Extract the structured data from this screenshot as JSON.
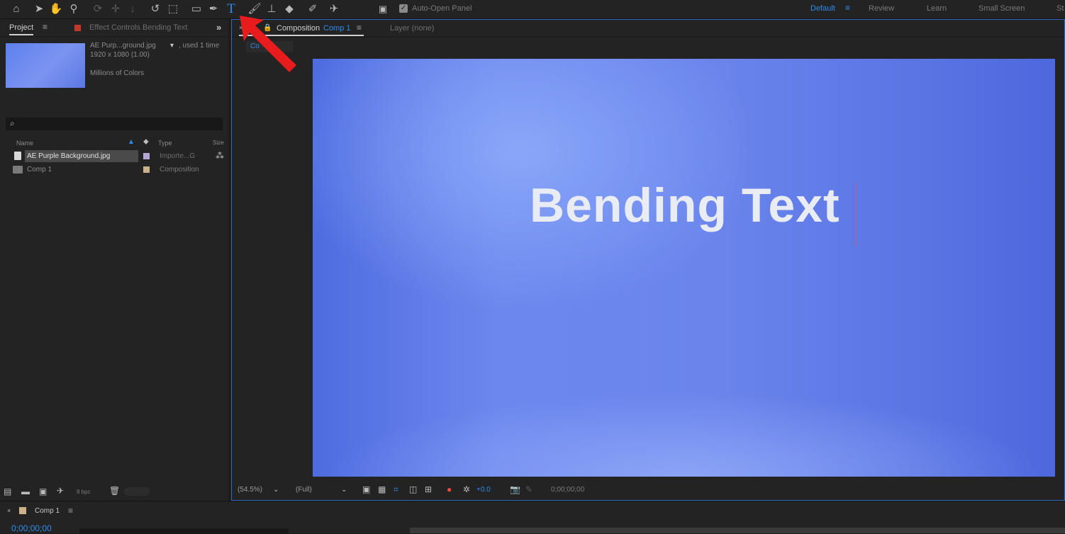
{
  "toolbar": {
    "auto_open_panel": "Auto-Open Panel",
    "workspaces": [
      "Default",
      "Review",
      "Learn",
      "Small Screen",
      "St"
    ],
    "active_workspace": "Default"
  },
  "project_panel": {
    "tab_project": "Project",
    "tab_effect_controls": "Effect Controls Bending Text",
    "preview_name": "AE Purp...ground.jpg",
    "preview_used": ", used 1 time",
    "preview_size": "1920 x 1080 (1.00)",
    "preview_colors": "Millions of Colors",
    "search_icon": "⌕",
    "columns": {
      "name": "Name",
      "type": "Type",
      "size": "Size"
    },
    "items": [
      {
        "name": "AE Purple Background.jpg",
        "type": "Importe...G",
        "swatch": "#b6a6d6"
      },
      {
        "name": "Comp 1",
        "type": "Composition",
        "swatch": "#c9b18a"
      }
    ],
    "bpc": "8 bpc"
  },
  "composition_panel": {
    "tab_label": "Composition",
    "comp_name": "Comp 1",
    "layer_tab": "Layer (none)",
    "subtab": "Co",
    "canvas_text": "Bending Text",
    "zoom": "(54.5%)",
    "resolution": "(Full)",
    "exposure": "+0.0",
    "timecode": "0;00;00;00"
  },
  "timeline": {
    "comp_tab": "Comp 1",
    "timecode": "0;00;00;00"
  },
  "colors": {
    "accent": "#2d8ceb",
    "arrow": "#e81c1c",
    "canvas_text": "#e9ecf3"
  }
}
